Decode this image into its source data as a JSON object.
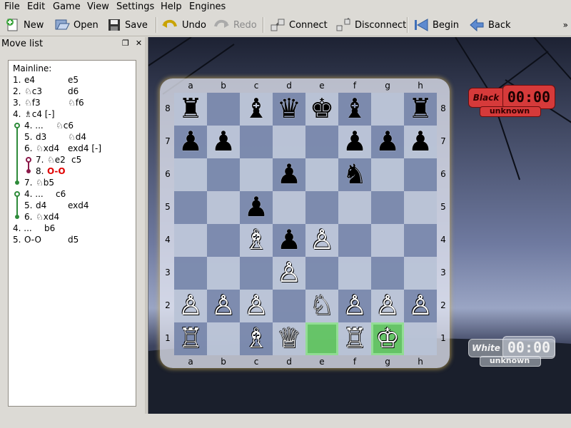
{
  "menu": [
    "File",
    "Edit",
    "Game",
    "View",
    "Settings",
    "Help",
    "Engines"
  ],
  "toolbar": {
    "new": "New",
    "open": "Open",
    "save": "Save",
    "undo": "Undo",
    "redo": "Redo",
    "connect": "Connect",
    "disconnect": "Disconnect",
    "begin": "Begin",
    "back": "Back"
  },
  "panel": {
    "title": "Move list"
  },
  "moves": {
    "mainline": "Mainline:",
    "l1": {
      "num": "1.",
      "w": "e4",
      "b": "e5"
    },
    "l2": {
      "num": "2.",
      "w": "♘c3",
      "b": "d6"
    },
    "l3": {
      "num": "3.",
      "w": "♘f3",
      "b": "♘f6"
    },
    "l4": {
      "num": "4.",
      "w": "♗c4 [-]"
    },
    "v1": {
      "num": "4. ...",
      "w": "♘c6"
    },
    "v2": {
      "num": "5.",
      "w": "d3",
      "b": "♘d4"
    },
    "v3": {
      "num": "6.",
      "w": "♘xd4",
      "b": "exd4 [-]"
    },
    "v4": {
      "num": "7.",
      "w": "♘e2",
      "b": "c5"
    },
    "v5": {
      "num": "8.",
      "w": "O-O"
    },
    "v6": {
      "num": "7.",
      "w": "♘b5"
    },
    "w1": {
      "num": "4. ...",
      "w": "c6"
    },
    "w2": {
      "num": "5.",
      "w": "d4",
      "b": "exd4"
    },
    "w3": {
      "num": "6.",
      "w": "♘xd4"
    },
    "m4": {
      "num": "4. ...",
      "w": "b6"
    },
    "m5": {
      "num": "5.",
      "w": "O-O",
      "b": "d5"
    }
  },
  "board": {
    "files": [
      "a",
      "b",
      "c",
      "d",
      "e",
      "f",
      "g",
      "h"
    ],
    "ranks": [
      "8",
      "7",
      "6",
      "5",
      "4",
      "3",
      "2",
      "1"
    ],
    "pieces": [
      [
        "♜",
        "",
        "♝",
        "♛",
        "♚",
        "♝",
        "",
        "♜"
      ],
      [
        "♟",
        "♟",
        "",
        "",
        "",
        "♟",
        "♟",
        "♟"
      ],
      [
        "",
        "",
        "",
        "♟",
        "",
        "♞",
        "",
        ""
      ],
      [
        "",
        "",
        "♟",
        "",
        "",
        "",
        "",
        ""
      ],
      [
        "",
        "",
        "♗",
        "♟",
        "♙",
        "",
        "",
        ""
      ],
      [
        "",
        "",
        "",
        "♙",
        "",
        "",
        "",
        ""
      ],
      [
        "♙",
        "♙",
        "♙",
        "",
        "♘",
        "♙",
        "♙",
        "♙"
      ],
      [
        "♖",
        "",
        "♗",
        "♕",
        "",
        "♖",
        "♔",
        ""
      ]
    ],
    "highlights": [
      "e1",
      "g1"
    ]
  },
  "clocks": {
    "black": {
      "label": "Black",
      "time": "00:00",
      "player": "unknown"
    },
    "white": {
      "label": "White",
      "time": "00:00",
      "player": "unknown"
    }
  },
  "colors": {
    "light": "#b8c2d6",
    "dark": "#7686aa",
    "highlight": "#5fc45f",
    "black_clock": "#d63a3a"
  }
}
